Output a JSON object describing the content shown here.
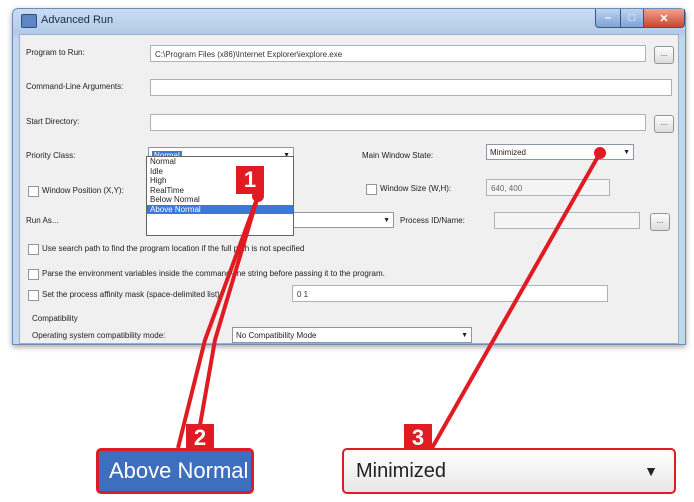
{
  "window": {
    "title": "Advanced Run"
  },
  "form": {
    "program_label": "Program to Run:",
    "program_value": "C:\\Program Files (x86)\\Internet Explorer\\iexplore.exe",
    "args_label": "Command-Line Arguments:",
    "args_value": "",
    "startdir_label": "Start Directory:",
    "startdir_value": "",
    "browse_label": "...",
    "priority_label": "Priority Class:",
    "priority_value": "Normal",
    "priority_options": [
      "Normal",
      "Idle",
      "High",
      "RealTime",
      "Below Normal",
      "Above Normal"
    ],
    "mainwin_label": "Main Window State:",
    "mainwin_value": "Minimized",
    "winpos_label": "Window Position (X,Y):",
    "winsize_label": "Window Size (W,H):",
    "winsize_value": "640, 400",
    "runas_label": "Run As...",
    "process_label": "Process ID/Name:",
    "process_value": "",
    "opt_searchpath": "Use search path to find the program location if the full path is not specified",
    "opt_parseenv": "Parse the environment variables inside the command-line string before passing it to the program.",
    "opt_affinity": "Set the process affinity mask (space-delimited list):",
    "affinity_value": "0 1",
    "compat_group": "Compatibility",
    "compat_label": "Operating system compatibility mode:",
    "compat_value": "No Compatibility Mode"
  },
  "callouts": {
    "one": "1",
    "two": "2",
    "three": "3"
  },
  "zoom": {
    "left_text": "Above Normal",
    "right_text": "Minimized"
  },
  "colors": {
    "accent_red": "#e01b24",
    "selection_blue": "#3a79d8"
  }
}
